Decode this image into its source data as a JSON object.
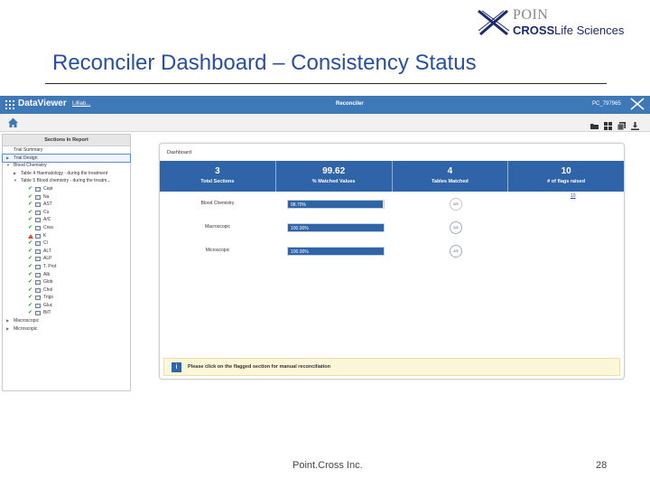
{
  "slide": {
    "logo_top": "POIN",
    "logo_cross": "CROSS",
    "logo_rest": "Life Sciences",
    "title": "Reconciler Dashboard – Consistency Status",
    "footer_company": "Point.Cross Inc.",
    "page_number": "28"
  },
  "app": {
    "name": "DataViewer",
    "study_link": "Lilliab...",
    "module": "Reconciler",
    "user": "PC_797965",
    "toolbar_icons": [
      "folder-open-icon",
      "grid-view-icon",
      "copy-icon",
      "download-icon"
    ]
  },
  "sidebar": {
    "title": "Sections In Report",
    "items": [
      {
        "label": "Trial Summary",
        "level": 0,
        "caret": "",
        "status": ""
      },
      {
        "label": "Trial Design",
        "level": 0,
        "caret": "▶",
        "status": "",
        "selected": true
      },
      {
        "label": "Blood Chemistry",
        "level": 0,
        "caret": "▼",
        "status": ""
      },
      {
        "label": "Table 4 Haematology - during the treatment",
        "level": 1,
        "caret": "▶",
        "status": ""
      },
      {
        "label": "Table 5 Blood chemistry - during the treatm...",
        "level": 1,
        "caret": "▼",
        "status": ""
      },
      {
        "label": "Cept",
        "level": 2,
        "status": "ok"
      },
      {
        "label": "Na",
        "level": 2,
        "status": "ok"
      },
      {
        "label": "AST",
        "level": 2,
        "status": "ok"
      },
      {
        "label": "Cu",
        "level": 2,
        "status": "ok"
      },
      {
        "label": "A/C",
        "level": 2,
        "status": "ok"
      },
      {
        "label": "Crea",
        "level": 2,
        "status": "ok"
      },
      {
        "label": "K",
        "level": 2,
        "status": "warn"
      },
      {
        "label": "Cl",
        "level": 2,
        "status": "ok"
      },
      {
        "label": "ALT",
        "level": 2,
        "status": "ok"
      },
      {
        "label": "ALP",
        "level": 2,
        "status": "ok"
      },
      {
        "label": "T. Prot",
        "level": 2,
        "status": "ok"
      },
      {
        "label": "Alb",
        "level": 2,
        "status": "ok"
      },
      {
        "label": "Glob",
        "level": 2,
        "status": "ok"
      },
      {
        "label": "Chol",
        "level": 2,
        "status": "ok"
      },
      {
        "label": "Trigs",
        "level": 2,
        "status": "ok"
      },
      {
        "label": "Gluc",
        "level": 2,
        "status": "ok"
      },
      {
        "label": "BilT",
        "level": 2,
        "status": "ok"
      },
      {
        "label": "Macroscopic",
        "level": 0,
        "caret": "▶",
        "status": ""
      },
      {
        "label": "Microscopic",
        "level": 0,
        "caret": "▶",
        "status": ""
      }
    ]
  },
  "dashboard": {
    "title": "Dashboard",
    "stats": [
      {
        "value": "3",
        "caption": "Total Sections"
      },
      {
        "value": "99.62",
        "caption": "% Matched Values"
      },
      {
        "value": "4",
        "caption": "Tables Matched"
      },
      {
        "value": "10",
        "caption": "# of flags raised"
      }
    ],
    "rows": [
      {
        "name": "Blood Chemistry",
        "percent": 98.7,
        "percent_label": "98.70%",
        "tables": "0/2",
        "flags": "10"
      },
      {
        "name": "Macroscopic",
        "percent": 100,
        "percent_label": "100.00%",
        "tables": "2/2",
        "flags": ""
      },
      {
        "name": "Microscopic",
        "percent": 100,
        "percent_label": "100.00%",
        "tables": "2/2",
        "flags": ""
      }
    ],
    "notice": "Please click on the flagged section for manual reconciliation"
  }
}
